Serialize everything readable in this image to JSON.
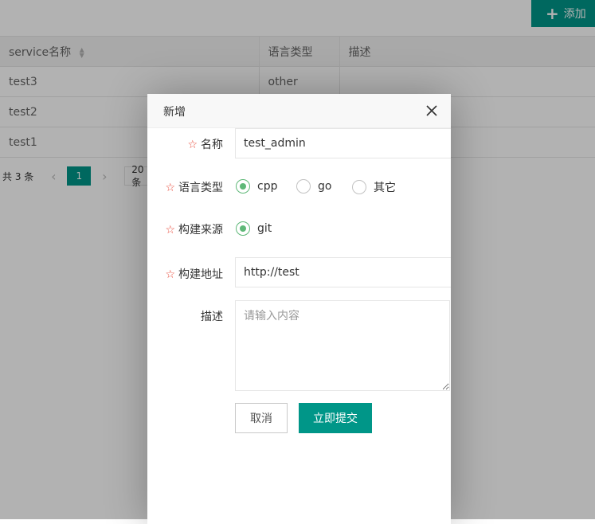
{
  "toolbar": {
    "add_label": "添加"
  },
  "table": {
    "headers": [
      "service名称",
      "语言类型",
      "描述"
    ],
    "rows": [
      {
        "name": "test3",
        "language": "other",
        "desc": ""
      },
      {
        "name": "test2",
        "language": "",
        "desc": ""
      },
      {
        "name": "test1",
        "language": "",
        "desc": ""
      }
    ]
  },
  "pager": {
    "total": "共 3 条",
    "current_page": "1",
    "page_size": "20 条"
  },
  "modal": {
    "title": "新增",
    "fields": {
      "name": {
        "label": "名称",
        "value": "test_admin"
      },
      "language": {
        "label": "语言类型",
        "options": [
          "cpp",
          "go",
          "其它"
        ],
        "selected": "cpp"
      },
      "source": {
        "label": "构建来源",
        "options": [
          "git"
        ],
        "selected": "git"
      },
      "address": {
        "label": "构建地址",
        "value": "http://test"
      },
      "description": {
        "label": "描述",
        "placeholder": "请输入内容"
      }
    },
    "cancel_label": "取消",
    "submit_label": "立即提交"
  },
  "colors": {
    "primary": "#009688",
    "radio_checked": "#5fb878",
    "required_star": "#e84c3d"
  }
}
